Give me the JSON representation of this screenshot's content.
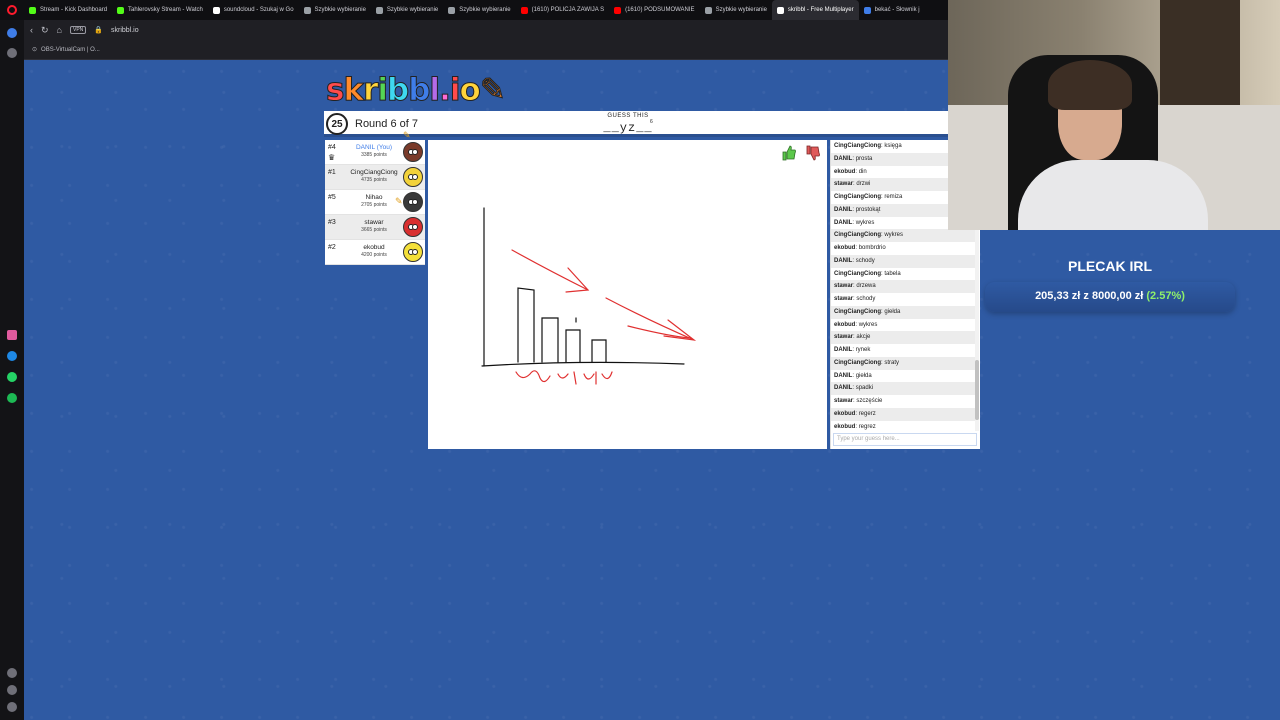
{
  "browser": {
    "tabs": [
      {
        "label": "Stream - Kick Dashboard",
        "color": "#53fc18"
      },
      {
        "label": "Tahlerovsky Stream - Watch",
        "color": "#53fc18"
      },
      {
        "label": "soundcloud - Szukaj w Go",
        "color": "#ffffff"
      },
      {
        "label": "Szybkie wybieranie",
        "color": "#9aa0a6"
      },
      {
        "label": "Szybkie wybieranie",
        "color": "#9aa0a6"
      },
      {
        "label": "Szybkie wybieranie",
        "color": "#9aa0a6"
      },
      {
        "label": "(1610) POLICJA ZAWIJA S",
        "color": "#ff0000"
      },
      {
        "label": "(1610) PODSUMOWANIE",
        "color": "#ff0000"
      },
      {
        "label": "Szybkie wybieranie",
        "color": "#9aa0a6"
      },
      {
        "label": "skribbl - Free Multiplayer",
        "color": "#ffffff",
        "active": true
      },
      {
        "label": "bekać - Słownik j",
        "color": "#3f7de8"
      }
    ],
    "vpn": "VPN",
    "url": "skribbl.io",
    "bookmark": "OBS-VirtualCam | O..."
  },
  "game": {
    "logo": "skribbl.io",
    "timer": "25",
    "round": "Round 6 of 7",
    "guess_title": "GUESS THIS",
    "word_hint": "__yz__",
    "word_length": "6",
    "players": [
      {
        "rank": "#4",
        "name": "DANIL (You)",
        "points": "3385 points",
        "you": true,
        "crown": true,
        "avatar_color": "#7a3b2a"
      },
      {
        "rank": "#1",
        "name": "CingCiangCiong",
        "points": "4735 points",
        "you": false,
        "crown": false,
        "avatar_color": "#f2d23a"
      },
      {
        "rank": "#5",
        "name": "Nihao",
        "points": "2705 points",
        "you": false,
        "crown": false,
        "avatar_color": "#3a3a3a"
      },
      {
        "rank": "#3",
        "name": "stawar",
        "points": "3665 points",
        "you": false,
        "crown": false,
        "avatar_color": "#d82f2f"
      },
      {
        "rank": "#2",
        "name": "ekobud",
        "points": "4200 points",
        "you": false,
        "crown": false,
        "avatar_color": "#f4e03a"
      }
    ],
    "chat": [
      {
        "user": "CingCiangCiong",
        "text": "księga"
      },
      {
        "user": "DANIL",
        "text": "prosta"
      },
      {
        "user": "ekobud",
        "text": "din"
      },
      {
        "user": "stawar",
        "text": "drzwi"
      },
      {
        "user": "CingCiangCiong",
        "text": "remiza"
      },
      {
        "user": "DANIL",
        "text": "prostokąt"
      },
      {
        "user": "DANIL",
        "text": "wykres"
      },
      {
        "user": "CingCiangCiong",
        "text": "wykres"
      },
      {
        "user": "ekobud",
        "text": "bombrdrio"
      },
      {
        "user": "DANIL",
        "text": "schody"
      },
      {
        "user": "CingCiangCiong",
        "text": "tabela"
      },
      {
        "user": "stawar",
        "text": "drzewa"
      },
      {
        "user": "stawar",
        "text": "schody"
      },
      {
        "user": "CingCiangCiong",
        "text": "giełda"
      },
      {
        "user": "ekobud",
        "text": "wykres"
      },
      {
        "user": "stawar",
        "text": "akcje"
      },
      {
        "user": "DANIL",
        "text": "rynek"
      },
      {
        "user": "CingCiangCiong",
        "text": "straty"
      },
      {
        "user": "DANIL",
        "text": "giełda"
      },
      {
        "user": "DANIL",
        "text": "spadki"
      },
      {
        "user": "stawar",
        "text": "szczęście"
      },
      {
        "user": "ekobud",
        "text": "regerz"
      },
      {
        "user": "ekobud",
        "text": "regrez"
      }
    ],
    "chat_placeholder": "Type your guess here..."
  },
  "overlay": {
    "title": "PLECAK IRL",
    "current": "205,33 zł",
    "connector": "z",
    "goal": "8000,00 zł",
    "percent": "(2.57%)",
    "colors": {
      "accent_green": "#8ff06a",
      "panel": "#2f5aa3"
    }
  },
  "colors": {
    "page_bg": "#2f5aa3",
    "you": "#3f7de8",
    "sketch_red": "#e03030"
  }
}
